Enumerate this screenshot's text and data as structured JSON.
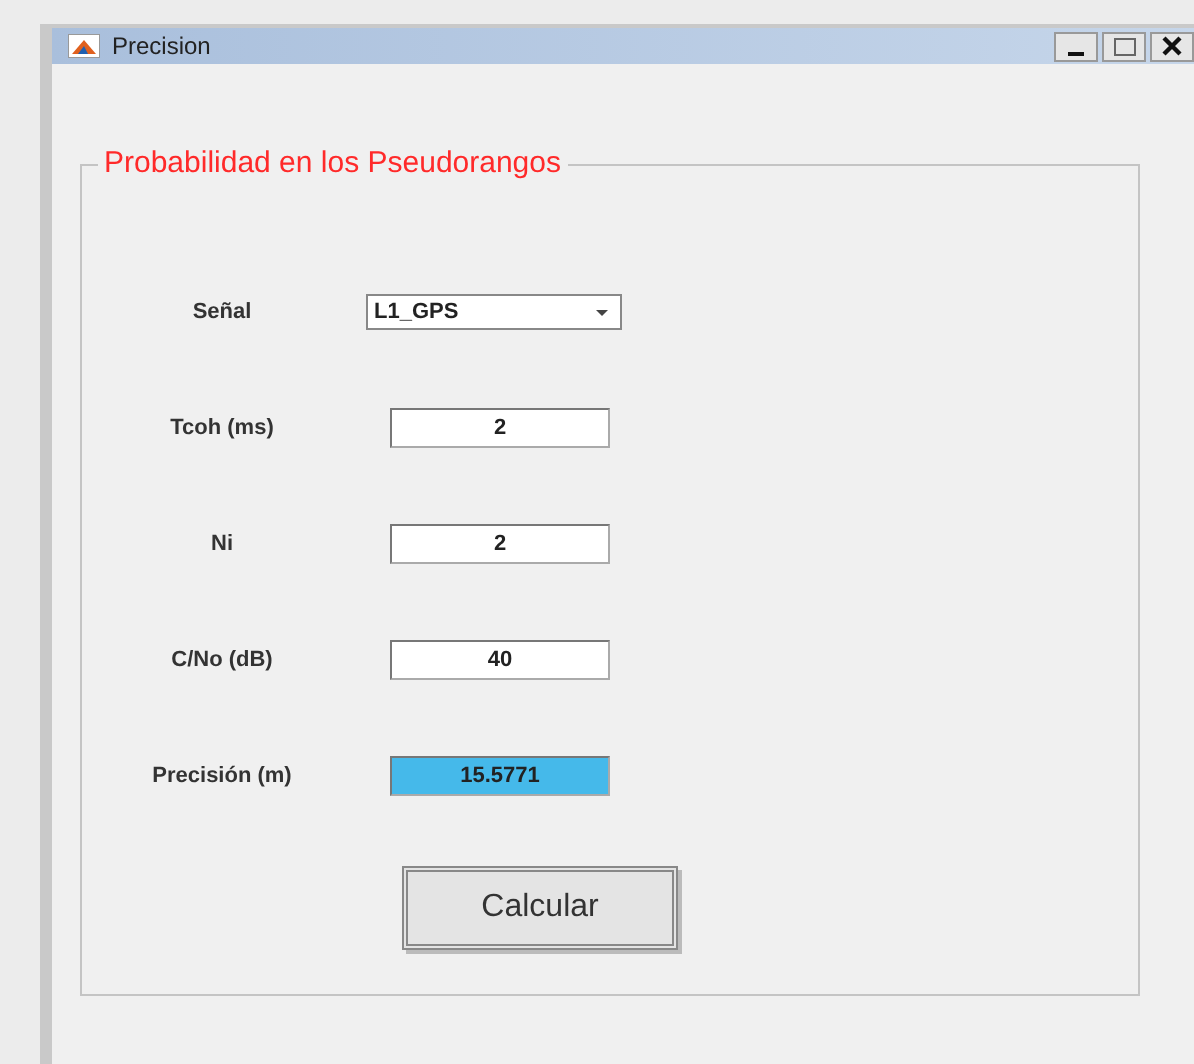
{
  "window": {
    "title": "Precision"
  },
  "panel": {
    "title": "Probabilidad en los Pseudorangos",
    "rows": [
      {
        "label": "Señal",
        "kind": "dropdown",
        "value": "L1_GPS"
      },
      {
        "label": "Tcoh (ms)",
        "kind": "input",
        "value": "2"
      },
      {
        "label": "Ni",
        "kind": "input",
        "value": "2"
      },
      {
        "label": "C/No (dB)",
        "kind": "input",
        "value": "40"
      },
      {
        "label": "Precisión (m)",
        "kind": "output",
        "value": "15.5771"
      }
    ]
  },
  "buttons": [
    "Calcular"
  ]
}
